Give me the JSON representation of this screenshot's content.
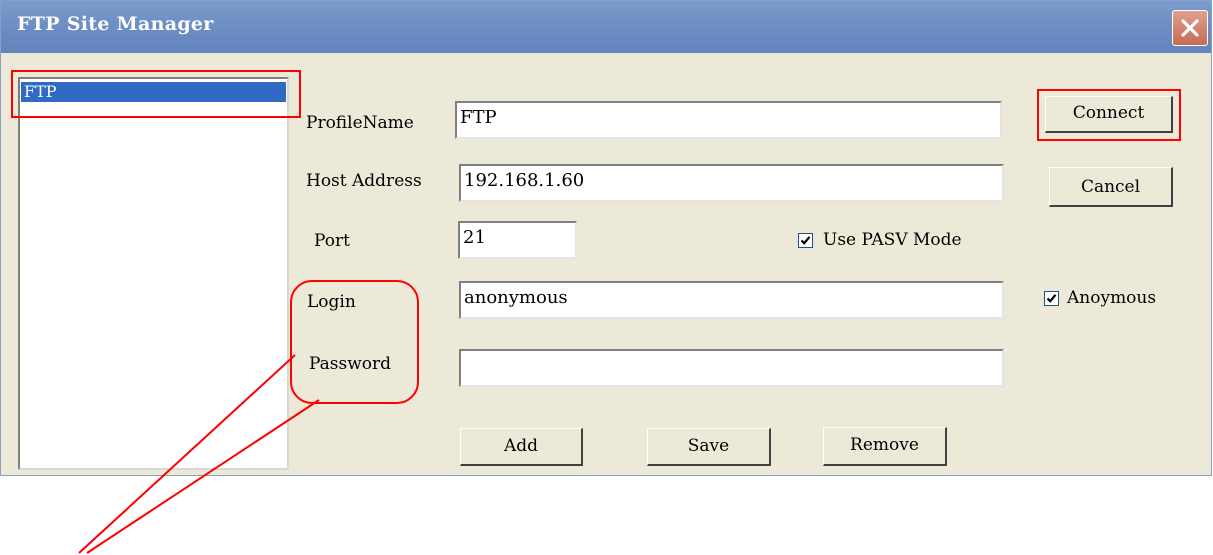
{
  "window": {
    "title": "FTP Site Manager"
  },
  "site_list": {
    "items": [
      "FTP"
    ]
  },
  "form": {
    "profile_name_label": "ProfileName",
    "profile_name_value": "FTP",
    "host_label": "Host Address",
    "host_value": "192.168.1.60",
    "port_label": "Port",
    "port_value": "21",
    "pasv_label": "Use PASV Mode",
    "pasv_checked": true,
    "login_label": "Login",
    "login_value": "anonymous",
    "anonymous_label": "Anoymous",
    "anonymous_checked": true,
    "password_label": "Password",
    "password_value": ""
  },
  "buttons": {
    "connect": "Connect",
    "cancel": "Cancel",
    "add": "Add",
    "save": "Save",
    "remove": "Remove"
  },
  "icons": {
    "close": "close-icon",
    "check": "check-icon"
  },
  "colors": {
    "annotation": "#ff0000",
    "title_bar": "#7292c7",
    "selection": "#316ac5"
  }
}
